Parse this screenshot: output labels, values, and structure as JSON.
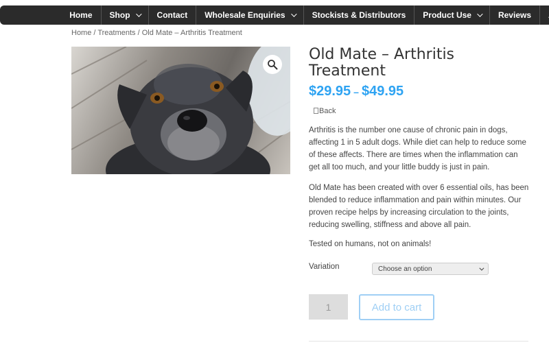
{
  "nav": {
    "items": [
      {
        "label": "Home",
        "dropdown": false
      },
      {
        "label": "Shop",
        "dropdown": true
      },
      {
        "label": "Contact",
        "dropdown": false
      },
      {
        "label": "Wholesale Enquiries",
        "dropdown": true
      },
      {
        "label": "Stockists & Distributors",
        "dropdown": false
      },
      {
        "label": "Product Use",
        "dropdown": true
      },
      {
        "label": "Reviews",
        "dropdown": false
      },
      {
        "label": "A",
        "dropdown": false
      }
    ]
  },
  "breadcrumb": {
    "home": "Home",
    "sep1": " / ",
    "category": "Treatments",
    "sep2": " / ",
    "current": "Old Mate – Arthritis Treatment"
  },
  "product": {
    "image_alt": "Grey staffordshire terrier dog",
    "zoom_icon": "magnifier-icon",
    "title": "Old Mate – Arthritis Treatment",
    "price_low": "$29.95",
    "price_sep": "–",
    "price_high": "$49.95",
    "back_label": "Back",
    "description": [
      "Arthritis is the number one cause of chronic pain in dogs, affecting 1 in 5 adult dogs. While diet can help to reduce some of these affects. There are times when the inflammation can get all too much, and your little buddy is just in pain.",
      "Old Mate has been created with over 6 essential oils, has been blended to reduce inflammation and pain within minutes. Our proven recipe helps by increasing circulation to the joints, reducing swelling, stiffness and above all pain.",
      "Tested on humans, not on animals!"
    ],
    "variation_label": "Variation",
    "variation_selected": "Choose an option",
    "quantity": "1",
    "add_to_cart": "Add to cart"
  },
  "colors": {
    "accent": "#2ea3f2",
    "nav_bg": "#2b2b2b",
    "button_disabled": "#9fcff5"
  }
}
